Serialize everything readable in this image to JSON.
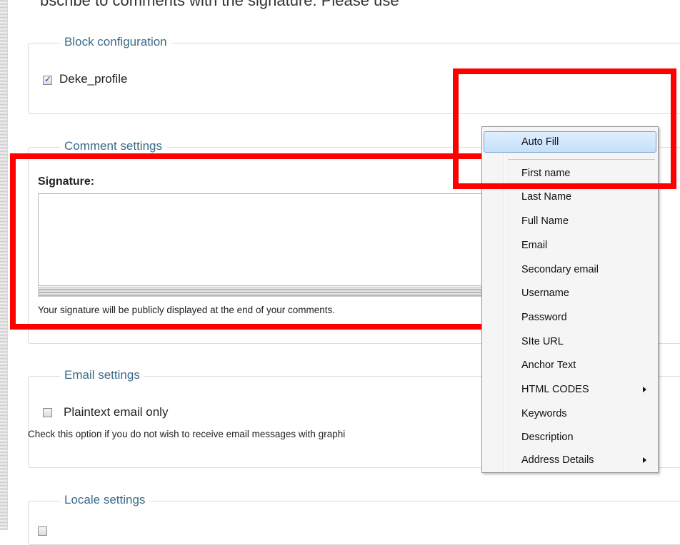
{
  "top_cut_text": "bscribe to comments with the signature. Please use",
  "block_config": {
    "legend": "Block configuration",
    "checkbox_label": "Deke_profile",
    "checked": true
  },
  "comment_settings": {
    "legend": "Comment settings",
    "signature_label": "Signature:",
    "signature_value": "",
    "help_text": "Your signature will be publicly displayed at the end of your comments."
  },
  "email_settings": {
    "legend": "Email settings",
    "checkbox_label": "Plaintext email only",
    "checked": false,
    "help_text": "Check this option if you do not wish to receive email messages with graphi"
  },
  "locale_settings": {
    "legend": "Locale settings"
  },
  "context_menu": {
    "header": "Auto Fill",
    "items": [
      {
        "label": "First name",
        "submenu": false
      },
      {
        "label": "Last Name",
        "submenu": false
      },
      {
        "label": "Full Name",
        "submenu": false
      },
      {
        "label": "Email",
        "submenu": false
      },
      {
        "label": "Secondary email",
        "submenu": false
      },
      {
        "label": "Username",
        "submenu": false
      },
      {
        "label": "Password",
        "submenu": false
      },
      {
        "label": "SIte URL",
        "submenu": false
      },
      {
        "label": "Anchor Text",
        "submenu": false
      },
      {
        "label": "HTML CODES",
        "submenu": true
      },
      {
        "label": "Keywords",
        "submenu": false
      },
      {
        "label": "Description",
        "submenu": false
      },
      {
        "label": "Address Details",
        "submenu": true
      }
    ]
  },
  "colors": {
    "annotation_red": "#ff0000",
    "legend_blue": "#3a6a88",
    "menu_highlight": "#c5e0fb"
  }
}
